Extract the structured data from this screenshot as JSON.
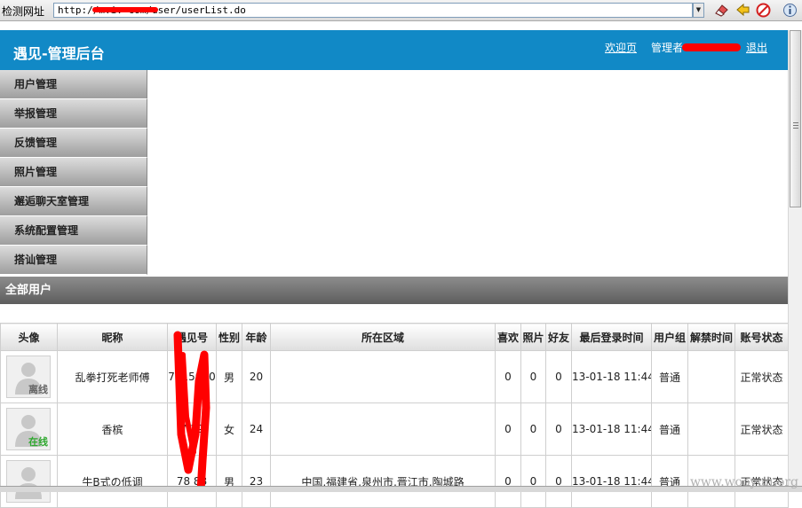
{
  "browser": {
    "address_label": "检测网址",
    "url": "http://m.i.        com/user/userList.do"
  },
  "header": {
    "title": "遇见-管理后台",
    "welcome_link": "欢迎页",
    "admin_label": "管理者",
    "logout_link": "退出"
  },
  "sidebar": {
    "items": [
      {
        "label": "用户管理"
      },
      {
        "label": "举报管理"
      },
      {
        "label": "反馈管理"
      },
      {
        "label": "照片管理"
      },
      {
        "label": "邂逅聊天室管理"
      },
      {
        "label": "系统配置管理"
      },
      {
        "label": "搭讪管理"
      }
    ]
  },
  "section": {
    "title": "全部用户"
  },
  "table": {
    "columns": [
      "头像",
      "昵称",
      "遇见号",
      "性别",
      "年龄",
      "所在区域",
      "喜欢",
      "照片",
      "好友",
      "最后登录时间",
      "用户组",
      "解禁时间",
      "账号状态"
    ],
    "rows": [
      {
        "status": "离线",
        "nickname": "乱拳打死老师傅",
        "id": "7315030",
        "gender": "男",
        "age": "20",
        "region": "",
        "likes": "0",
        "photos": "0",
        "friends": "0",
        "last_login": "13-01-18 11:44",
        "group": "普通",
        "unban": "",
        "account": "正常状态"
      },
      {
        "status": "在线",
        "nickname": "香槟",
        "id": "7   39",
        "gender": "女",
        "age": "24",
        "region": "",
        "likes": "0",
        "photos": "0",
        "friends": "0",
        "last_login": "13-01-18 11:44",
        "group": "普通",
        "unban": "",
        "account": "正常状态"
      },
      {
        "status": "",
        "nickname": "牛B式の低调",
        "id": "78  88",
        "gender": "男",
        "age": "23",
        "region": "中国,福建省,泉州市,晋江市,陶城路",
        "likes": "0",
        "photos": "0",
        "friends": "0",
        "last_login": "13-01-18 11:44",
        "group": "普通",
        "unban": "",
        "account": "正常状态"
      }
    ]
  },
  "watermark": "www.wooyun.org",
  "colors": {
    "header_bg": "#1189c6",
    "offline": "#666666",
    "online": "#2fa82f",
    "redaction": "#ff0000"
  }
}
